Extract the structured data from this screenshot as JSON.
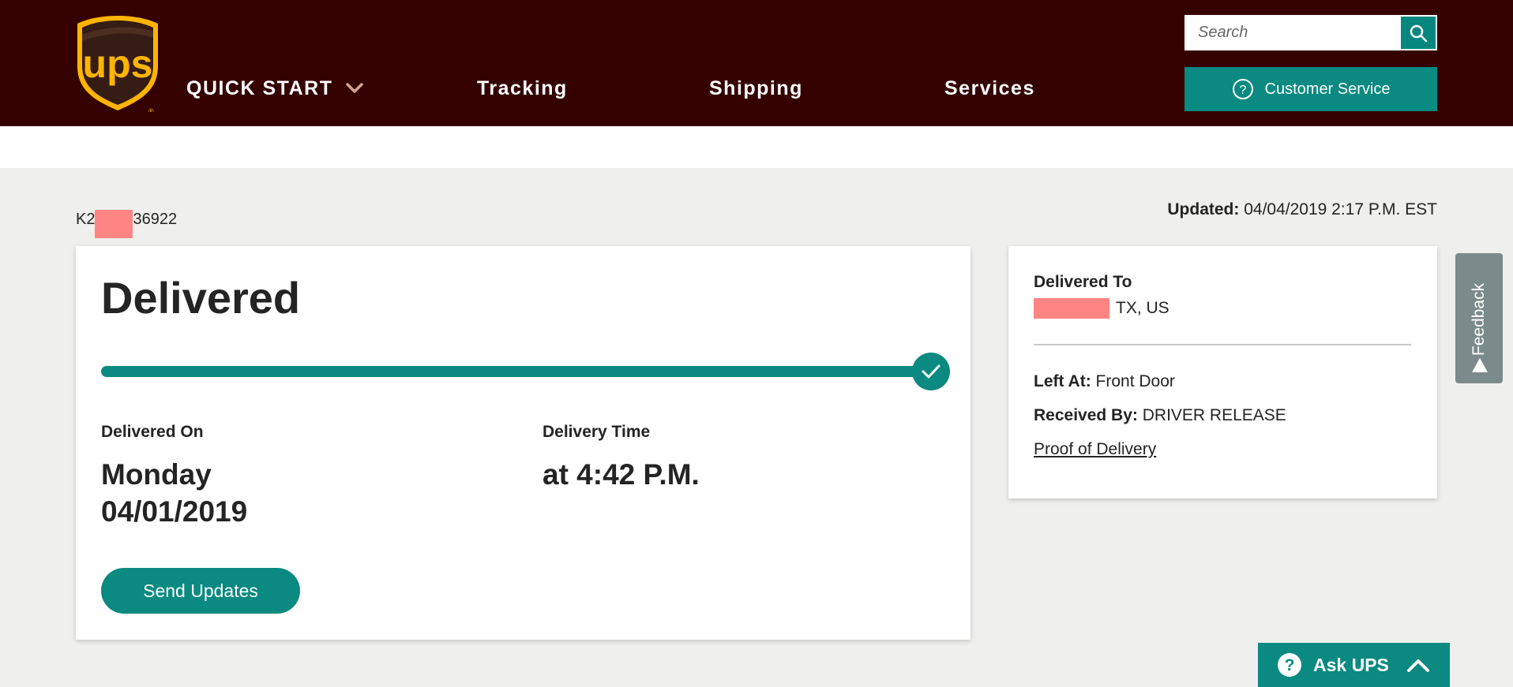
{
  "header": {
    "logo_text": "ups",
    "nav": [
      {
        "label": "QUICK START"
      },
      {
        "label": "Tracking"
      },
      {
        "label": "Shipping"
      },
      {
        "label": "Services"
      }
    ],
    "search_placeholder": "Search",
    "customer_service_label": "Customer Service"
  },
  "tracking": {
    "number_prefix": "K2",
    "number_suffix": "36922",
    "updated_label": "Updated:",
    "updated_value": "04/04/2019 2:17 P.M. EST"
  },
  "status_card": {
    "status": "Delivered",
    "progress_fraction": 1.0,
    "delivered_on_label": "Delivered On",
    "delivered_on_day": "Monday",
    "delivered_on_date": "04/01/2019",
    "delivery_time_label": "Delivery Time",
    "delivery_time_value": "at 4:42 P.M.",
    "send_updates_label": "Send Updates"
  },
  "side_card": {
    "delivered_to_label": "Delivered To",
    "delivered_to_value": "TX, US",
    "left_at_label": "Left At:",
    "left_at_value": "Front Door",
    "received_by_label": "Received By:",
    "received_by_value": "DRIVER RELEASE",
    "proof_link": "Proof of Delivery"
  },
  "feedback_label": "Feedback",
  "ask_ups_label": "Ask UPS",
  "colors": {
    "header_bg": "#350000",
    "teal": "#0a8a80",
    "page_bg": "#efefed",
    "ups_gold": "#ffb500",
    "ups_brown": "#351c15",
    "redaction": "#ff8585"
  },
  "icons": [
    "ups-logo",
    "chevron-down-icon",
    "search-icon",
    "question-circle-icon",
    "checkmark-icon",
    "triangle-up-icon",
    "chevron-up-icon"
  ]
}
